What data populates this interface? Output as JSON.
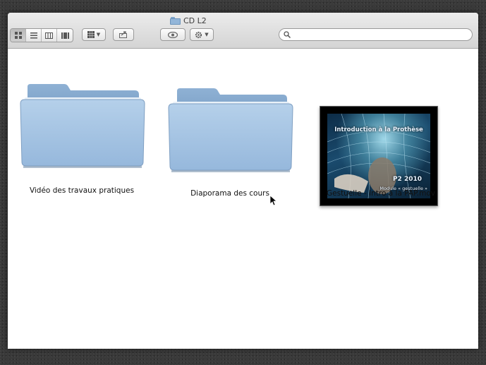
{
  "window": {
    "title": "CD L2"
  },
  "search": {
    "placeholder": "",
    "value": ""
  },
  "items": [
    {
      "label": "Vidéo des travaux pratiques",
      "kind": "folder",
      "icon": "folder-icon"
    },
    {
      "label": "Diaporama des cours",
      "kind": "folder",
      "icon": "folder-icon"
    },
    {
      "label": "Gestuelle - Intro à la PAP.mov",
      "kind": "movie",
      "icon": "movie-thumbnail"
    }
  ],
  "thumbnail": {
    "title": "Introduction à la Prothèse",
    "subtitle": "P2 2010",
    "caption": "Module « gestuelle »"
  },
  "colors": {
    "folder": "#a9c6e3",
    "toolbar": "#dcdcdc"
  }
}
